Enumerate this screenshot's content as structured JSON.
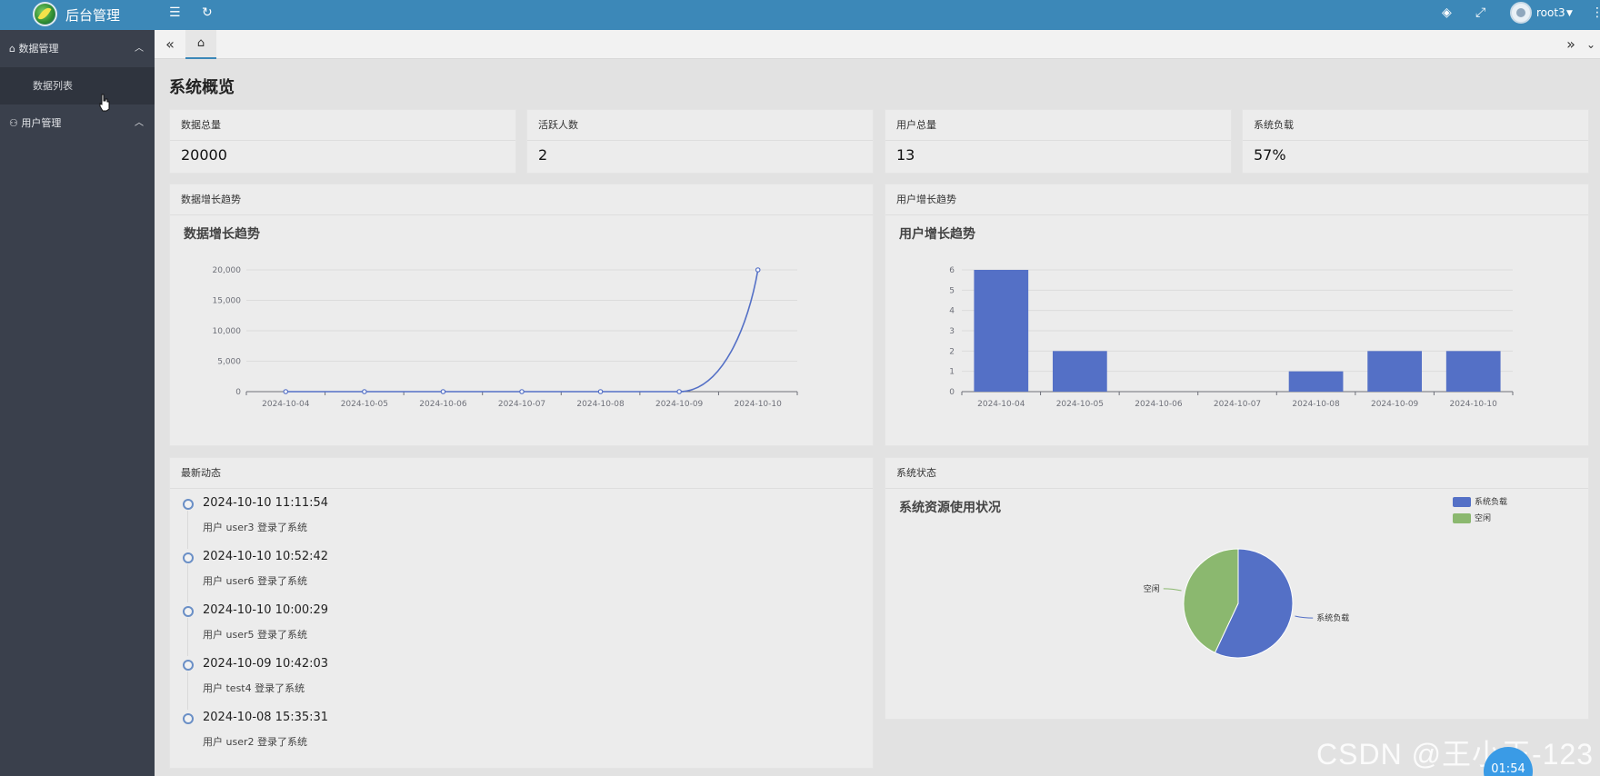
{
  "header": {
    "brand": "后台管理",
    "username": "root3",
    "icons": [
      "menu-toggle-icon",
      "refresh-icon",
      "tag-icon",
      "fullscreen-icon",
      "caret-down-icon",
      "more-vertical-icon"
    ]
  },
  "sidebar": {
    "groups": [
      {
        "label": "数据管理",
        "icon": "home-icon",
        "expanded": true,
        "items": [
          {
            "label": "数据列表"
          }
        ]
      },
      {
        "label": "用户管理",
        "icon": "user-icon",
        "expanded": true,
        "items": []
      }
    ]
  },
  "tabs": {
    "home_icon": "home-icon"
  },
  "page": {
    "title": "系统概览"
  },
  "stats": [
    {
      "label": "数据总量",
      "value": "20000"
    },
    {
      "label": "活跃人数",
      "value": "2"
    },
    {
      "label": "用户总量",
      "value": "13"
    },
    {
      "label": "系统负载",
      "value": "57%"
    }
  ],
  "panels": {
    "data_growth": "数据增长趋势",
    "user_growth": "用户增长趋势",
    "recent": "最新动态",
    "system": "系统状态"
  },
  "timeline": [
    {
      "time": "2024-10-10 11:11:54",
      "text": "用户 user3 登录了系统"
    },
    {
      "time": "2024-10-10 10:52:42",
      "text": "用户 user6 登录了系统"
    },
    {
      "time": "2024-10-10 10:00:29",
      "text": "用户 user5 登录了系统"
    },
    {
      "time": "2024-10-09 10:42:03",
      "text": "用户 test4 登录了系统"
    },
    {
      "time": "2024-10-08 15:35:31",
      "text": "用户 user2 登录了系统"
    }
  ],
  "chart_data": [
    {
      "type": "line",
      "title": "数据增长趋势",
      "x": [
        "2024-10-04",
        "2024-10-05",
        "2024-10-06",
        "2024-10-07",
        "2024-10-08",
        "2024-10-09",
        "2024-10-10"
      ],
      "values": [
        0,
        0,
        0,
        0,
        0,
        0,
        20000
      ],
      "yticks": [
        "0",
        "5,000",
        "10,000",
        "15,000",
        "20,000"
      ],
      "ylim": [
        0,
        20000
      ],
      "smooth": true,
      "grid": true,
      "color": "#5470c6"
    },
    {
      "type": "bar",
      "title": "用户增长趋势",
      "categories": [
        "2024-10-04",
        "2024-10-05",
        "2024-10-06",
        "2024-10-07",
        "2024-10-08",
        "2024-10-09",
        "2024-10-10"
      ],
      "values": [
        6,
        2,
        0,
        0,
        1,
        2,
        2
      ],
      "yticks": [
        "0",
        "1",
        "2",
        "3",
        "4",
        "5",
        "6"
      ],
      "ylim": [
        0,
        6
      ],
      "grid": true,
      "color": "#5470c6"
    },
    {
      "type": "pie",
      "title": "系统资源使用状况",
      "slices": [
        {
          "label": "系统负载",
          "value": 57,
          "color": "#5470c6"
        },
        {
          "label": "空闲",
          "value": 43,
          "color": "#8bb86f"
        }
      ],
      "legend": "top-right"
    }
  ],
  "watermark": "CSDN @王小王-123",
  "timer": "01:54"
}
